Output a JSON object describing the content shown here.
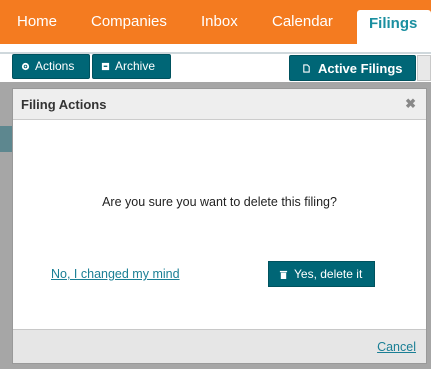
{
  "nav": {
    "items": [
      {
        "label": "Home"
      },
      {
        "label": "Companies"
      },
      {
        "label": "Inbox"
      },
      {
        "label": "Calendar"
      },
      {
        "label": "Filings"
      }
    ],
    "active_index": 4
  },
  "toolbar": {
    "actions_label": "Actions",
    "archive_label": "Archive",
    "active_filings_label": "Active Filings"
  },
  "dialog": {
    "title": "Filing Actions",
    "close_icon": "close-icon",
    "question": "Are you sure you want to delete this filing?",
    "no_label": "No, I changed my mind",
    "yes_label": "Yes, delete it",
    "cancel_label": "Cancel"
  },
  "colors": {
    "nav_bg": "#f47b20",
    "accent_dark": "#006676",
    "link": "#1a7f95",
    "active_tab_text": "#1a8fa0"
  }
}
